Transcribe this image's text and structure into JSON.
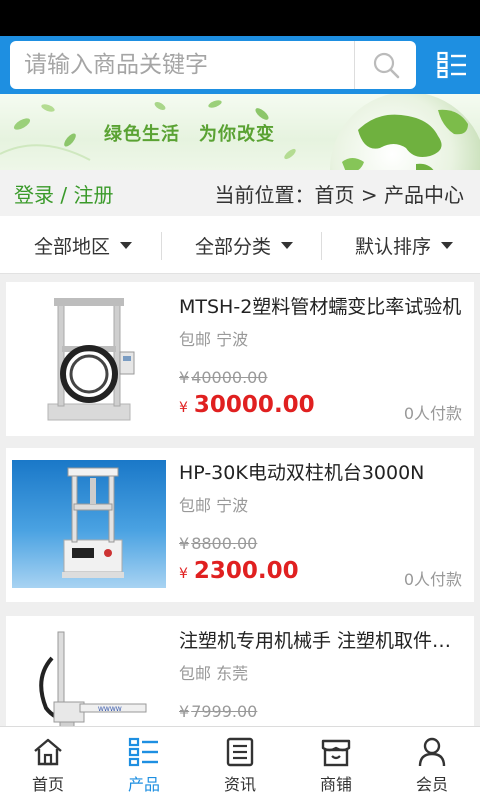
{
  "search": {
    "placeholder": "请输入商品关键字"
  },
  "banner": {
    "slogan": "绿色生活　为你改变"
  },
  "location": {
    "login_register": "登录 / 注册",
    "breadcrumb": "当前位置：首页 > 产品中心"
  },
  "filters": [
    {
      "label": "全部地区"
    },
    {
      "label": "全部分类"
    },
    {
      "label": "默认排序"
    }
  ],
  "products": [
    {
      "title": "MTSH-2塑料管材蠕变比率试验机",
      "shipping": "包邮",
      "city": "宁波",
      "meta": "包邮 宁波",
      "original_price": "40000.00",
      "price": "30000.00",
      "paid": "0人付款",
      "currency": "¥"
    },
    {
      "title": "HP-30K电动双柱机台3000N",
      "shipping": "包邮",
      "city": "宁波",
      "meta": "包邮 宁波",
      "original_price": "8800.00",
      "price": "2300.00",
      "paid": "0人付款",
      "currency": "¥"
    },
    {
      "title": "注塑机专用机械手 注塑机取件机械手",
      "shipping": "包邮",
      "city": "东莞",
      "meta": "包邮 东莞",
      "original_price": "7999.00",
      "price": "",
      "paid": "",
      "currency": "¥"
    }
  ],
  "tabs": [
    {
      "label": "首页",
      "icon": "home-icon"
    },
    {
      "label": "产品",
      "icon": "list-icon",
      "active": true
    },
    {
      "label": "资讯",
      "icon": "news-icon"
    },
    {
      "label": "商铺",
      "icon": "store-icon"
    },
    {
      "label": "会员",
      "icon": "user-icon"
    }
  ],
  "colors": {
    "primary": "#1e8fe1",
    "price": "#e02020",
    "login": "#3a9a2a",
    "slogan": "#5aa233"
  }
}
